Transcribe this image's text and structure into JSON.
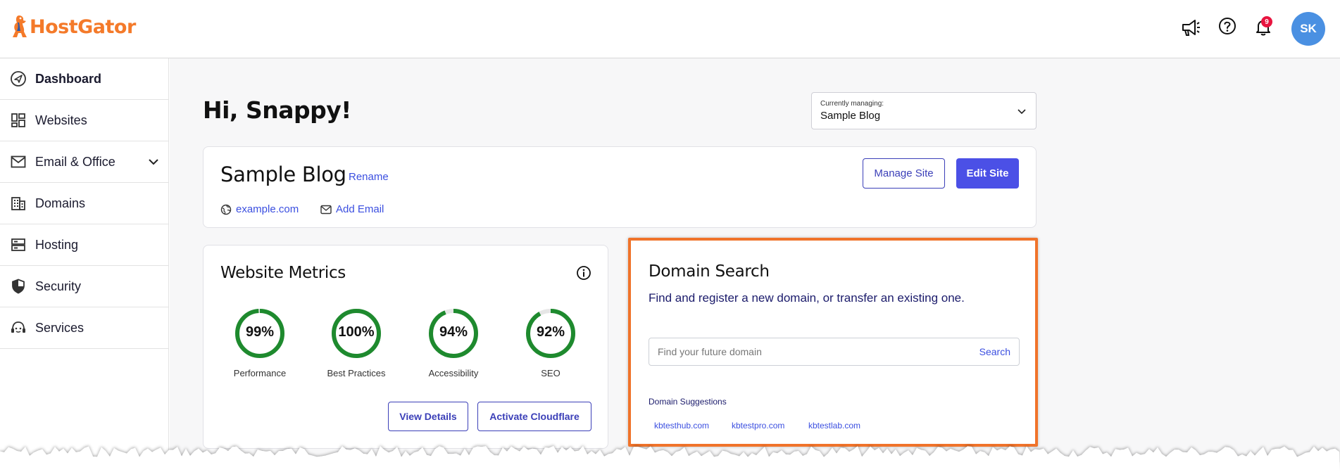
{
  "brand": {
    "name": "HostGator",
    "color": "#f47a2a"
  },
  "header": {
    "icons": [
      "megaphone-icon",
      "help-icon",
      "bell-icon"
    ],
    "notification_count": "9",
    "avatar_initials": "SK"
  },
  "sidebar": {
    "items": [
      {
        "label": "Dashboard",
        "icon": "compass-icon",
        "active": true
      },
      {
        "label": "Websites",
        "icon": "grid-icon"
      },
      {
        "label": "Email & Office",
        "icon": "envelope-icon",
        "expandable": true
      },
      {
        "label": "Domains",
        "icon": "building-icon"
      },
      {
        "label": "Hosting",
        "icon": "server-icon"
      },
      {
        "label": "Security",
        "icon": "shield-icon"
      },
      {
        "label": "Services",
        "icon": "headset-icon"
      }
    ]
  },
  "main": {
    "greeting": "Hi, Snappy!",
    "managing": {
      "label": "Currently managing:",
      "value": "Sample Blog"
    },
    "site": {
      "title": "Sample Blog",
      "rename": "Rename",
      "domain": "example.com",
      "add_email": "Add Email",
      "manage_button": "Manage Site",
      "edit_button": "Edit Site"
    },
    "metrics": {
      "title": "Website Metrics",
      "gauges": [
        {
          "value": "99%",
          "label": "Performance",
          "percent": 99
        },
        {
          "value": "100%",
          "label": "Best Practices",
          "percent": 100
        },
        {
          "value": "94%",
          "label": "Accessibility",
          "percent": 94
        },
        {
          "value": "92%",
          "label": "SEO",
          "percent": 92
        }
      ],
      "view_details": "View Details",
      "activate_cloudflare": "Activate Cloudflare"
    },
    "domain_search": {
      "title": "Domain Search",
      "subtitle": "Find and register a new domain, or transfer an existing one.",
      "placeholder": "Find your future domain",
      "search_button": "Search",
      "suggestions_title": "Domain Suggestions",
      "suggestions": [
        "kbtesthub.com",
        "kbtestpro.com",
        "kbtestlab.com"
      ]
    }
  },
  "colors": {
    "accent": "#4b50e6",
    "link": "#3b4fe0",
    "gauge_green": "#1e8a2e",
    "highlight_border": "#f0732a",
    "badge": "#e8143f",
    "avatar": "#4a90e2"
  }
}
